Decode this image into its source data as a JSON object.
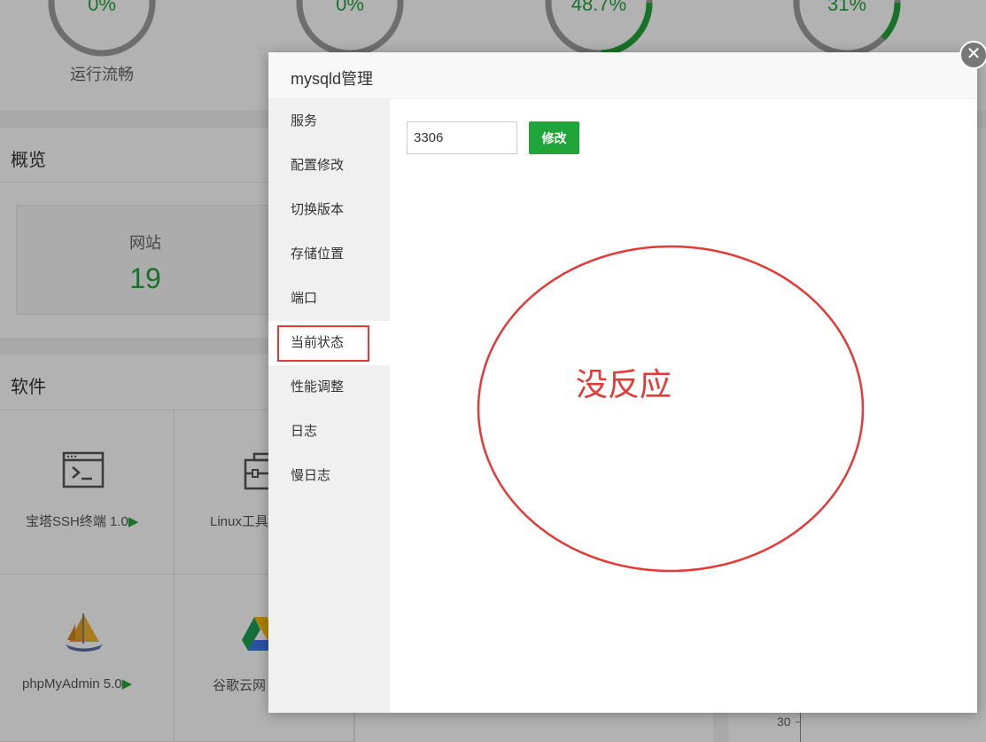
{
  "background": {
    "gauges": [
      {
        "value": "0%",
        "percent": 0
      },
      {
        "value": "0%",
        "percent": 0
      },
      {
        "value": "48.7%",
        "percent": 48.7
      },
      {
        "value": "31%",
        "percent": 31
      }
    ],
    "gauge_caption": "运行流畅",
    "overview": {
      "title": "概览",
      "card_label": "网站",
      "card_value": "19"
    },
    "software": {
      "title": "软件",
      "items": [
        {
          "name": "宝塔SSH终端 1.0",
          "arrow": "▶"
        },
        {
          "name": "Linux工具",
          "arrow": ""
        },
        {
          "name": "phpMyAdmin 5.0",
          "arrow": "▶"
        },
        {
          "name": "谷歌云网",
          "arrow": ""
        }
      ]
    },
    "axis_tick": "30"
  },
  "modal": {
    "title": "mysqld管理",
    "close_glyph": "✕",
    "nav_items": [
      "服务",
      "配置修改",
      "切换版本",
      "存储位置",
      "端口",
      "当前状态",
      "性能调整",
      "日志",
      "慢日志"
    ],
    "active_index": 5,
    "port_value": "3306",
    "modify_label": "修改"
  },
  "annotation": {
    "text": "没反应",
    "color": "#e53935"
  },
  "colors": {
    "accent": "#20a53a",
    "annotation": "#e53935"
  }
}
